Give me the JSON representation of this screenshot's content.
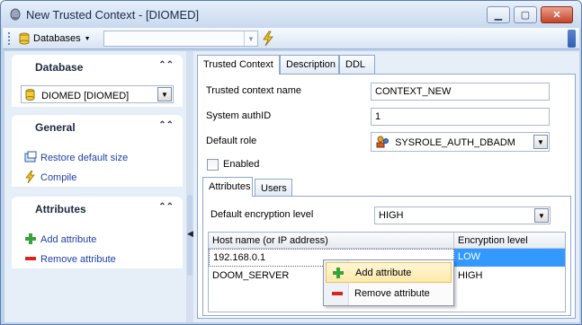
{
  "window": {
    "title": "New Trusted Context - [DIOMED]"
  },
  "toolbar": {
    "databases_label": "Databases",
    "combo_value": ""
  },
  "left": {
    "database": {
      "header": "Database",
      "selected": "DIOMED [DIOMED]"
    },
    "general": {
      "header": "General",
      "items": [
        "Restore default size",
        "Compile"
      ]
    },
    "attributes": {
      "header": "Attributes",
      "items": [
        "Add attribute",
        "Remove attribute"
      ]
    }
  },
  "tabs": [
    "Trusted Context",
    "Description",
    "DDL"
  ],
  "form": {
    "name_label": "Trusted context name",
    "name_value": "CONTEXT_NEW",
    "authid_label": "System authID",
    "authid_value": "1",
    "role_label": "Default role",
    "role_value": "SYSROLE_AUTH_DBADM",
    "enabled_label": "Enabled"
  },
  "subtabs": [
    "Attributes",
    "Users"
  ],
  "attributes": {
    "enc_label": "Default encryption level",
    "enc_value": "HIGH",
    "columns": [
      "Host name (or IP address)",
      "Encryption level"
    ],
    "rows": [
      {
        "host": "192.168.0.1",
        "level": "LOW"
      },
      {
        "host": "DOOM_SERVER",
        "level": "HIGH"
      }
    ]
  },
  "context_menu": [
    "Add attribute",
    "Remove attribute"
  ]
}
